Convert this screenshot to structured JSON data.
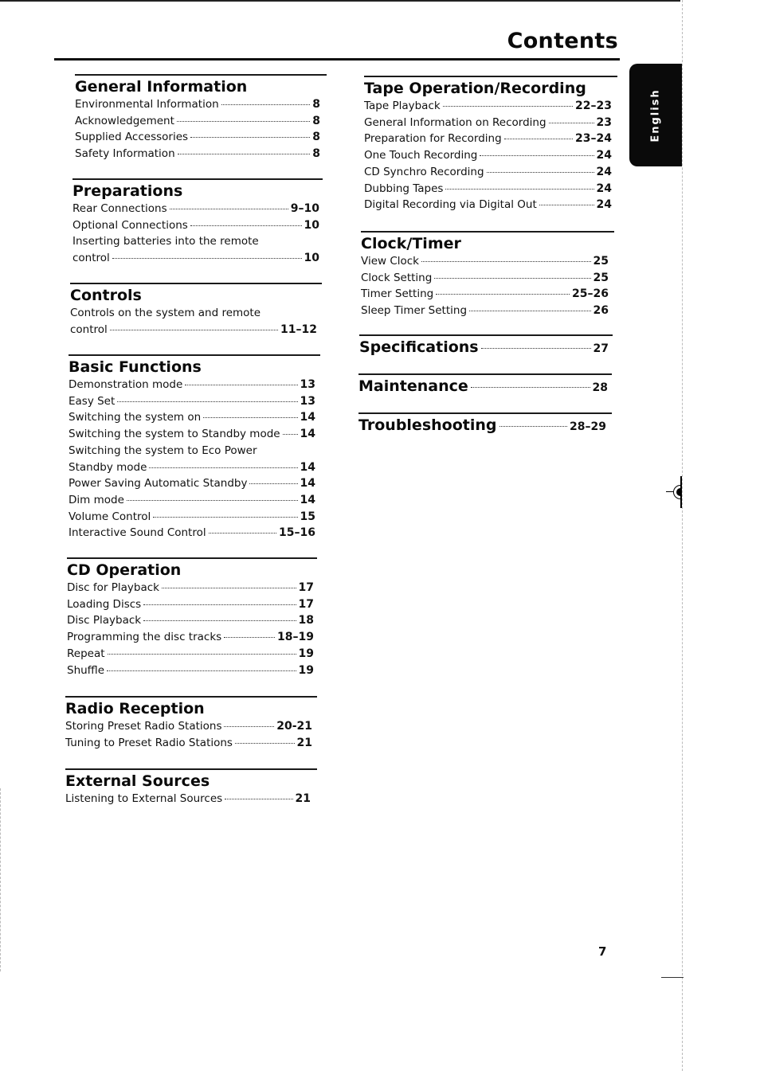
{
  "page": {
    "title": "Contents",
    "language_tab": "English",
    "page_number": "7"
  },
  "left_column": [
    {
      "heading": "General Information",
      "entries": [
        {
          "label": "Environmental Information",
          "page": "8"
        },
        {
          "label": "Acknowledgement",
          "page": "8"
        },
        {
          "label": "Supplied Accessories",
          "page": "8"
        },
        {
          "label": "Safety Information",
          "page": "8"
        }
      ]
    },
    {
      "heading": "Preparations",
      "entries": [
        {
          "label": "Rear Connections",
          "page": "9–10"
        },
        {
          "label": "Optional Connections",
          "page": "10"
        },
        {
          "label_line1": "Inserting batteries into the remote",
          "label": "control",
          "page": "10"
        }
      ]
    },
    {
      "heading": "Controls",
      "entries": [
        {
          "label_line1": "Controls on the system and remote",
          "label": "control",
          "page": "11–12"
        }
      ]
    },
    {
      "heading": "Basic Functions",
      "entries": [
        {
          "label": "Demonstration mode",
          "page": "13"
        },
        {
          "label": "Easy Set",
          "page": "13"
        },
        {
          "label": "Switching the system on",
          "page": "14"
        },
        {
          "label": "Switching the system to Standby mode",
          "page": "14"
        },
        {
          "label_line1": "Switching the system to Eco Power",
          "label": "Standby mode",
          "page": "14"
        },
        {
          "label": "Power Saving Automatic Standby",
          "page": "14"
        },
        {
          "label": "Dim mode",
          "page": "14"
        },
        {
          "label": "Volume Control",
          "page": "15"
        },
        {
          "label": "Interactive Sound Control",
          "page": "15–16"
        }
      ]
    },
    {
      "heading": "CD Operation",
      "entries": [
        {
          "label": "Disc for Playback",
          "page": "17"
        },
        {
          "label": "Loading Discs",
          "page": "17"
        },
        {
          "label": "Disc Playback",
          "page": "18"
        },
        {
          "label": "Programming the disc tracks",
          "page": "18–19"
        },
        {
          "label": "Repeat",
          "page": "19"
        },
        {
          "label": "Shuffle",
          "page": "19"
        }
      ]
    },
    {
      "heading": "Radio Reception",
      "entries": [
        {
          "label": "Storing Preset Radio Stations",
          "page": "20-21"
        },
        {
          "label": "Tuning to Preset Radio Stations",
          "page": "21"
        }
      ]
    },
    {
      "heading": "External Sources",
      "entries": [
        {
          "label": "Listening to External Sources",
          "page": "21"
        }
      ]
    }
  ],
  "right_column": [
    {
      "heading": "Tape Operation/Recording",
      "entries": [
        {
          "label": "Tape Playback",
          "page": "22–23"
        },
        {
          "label": "General Information on Recording",
          "page": "23"
        },
        {
          "label": "Preparation for Recording",
          "page": "23–24"
        },
        {
          "label": "One Touch Recording",
          "page": "24"
        },
        {
          "label": "CD Synchro Recording",
          "page": "24"
        },
        {
          "label": "Dubbing Tapes",
          "page": "24"
        },
        {
          "label": "Digital Recording via Digital Out",
          "page": "24"
        }
      ]
    },
    {
      "heading": "Clock/Timer",
      "entries": [
        {
          "label": "View Clock",
          "page": "25"
        },
        {
          "label": "Clock Setting",
          "page": "25"
        },
        {
          "label": "Timer Setting",
          "page": "25–26"
        },
        {
          "label": "Sleep Timer Setting",
          "page": "26"
        }
      ]
    },
    {
      "heading": "Specifications",
      "page": "27"
    },
    {
      "heading": "Maintenance",
      "page": "28"
    },
    {
      "heading": "Troubleshooting",
      "page": "28–29"
    }
  ]
}
